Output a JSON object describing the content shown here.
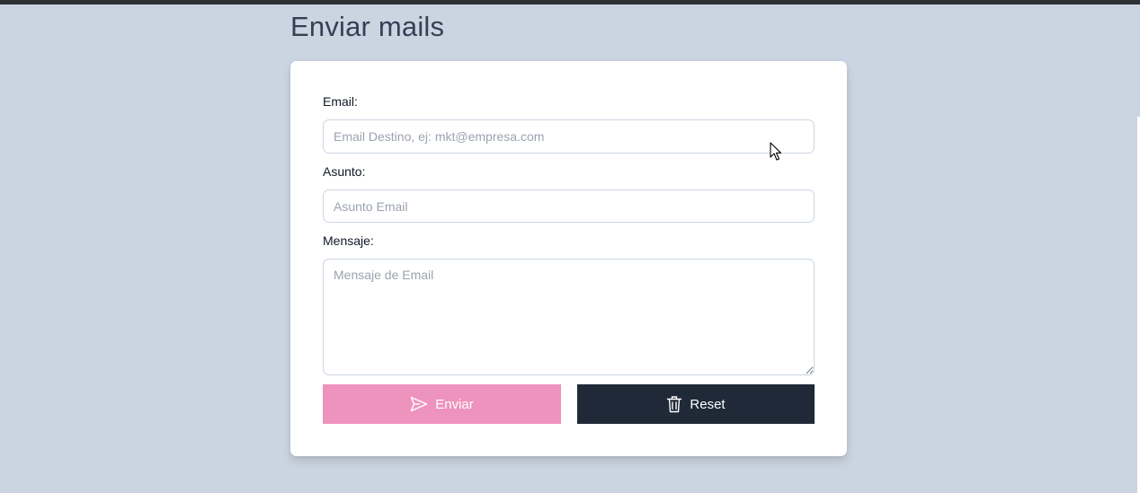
{
  "header": {
    "title": "Enviar mails"
  },
  "form": {
    "email": {
      "label": "Email:",
      "placeholder": "Email Destino, ej: mkt@empresa.com",
      "value": ""
    },
    "subject": {
      "label": "Asunto:",
      "placeholder": "Asunto Email",
      "value": ""
    },
    "message": {
      "label": "Mensaje:",
      "placeholder": "Mensaje de Email",
      "value": ""
    },
    "send_button": {
      "label": "Enviar",
      "icon": "send-icon",
      "color": "#ee93bd"
    },
    "reset_button": {
      "label": "Reset",
      "icon": "trash-icon",
      "color": "#1f2937"
    }
  },
  "theme": {
    "background": "#cbd5e1",
    "title_color": "#334155"
  }
}
